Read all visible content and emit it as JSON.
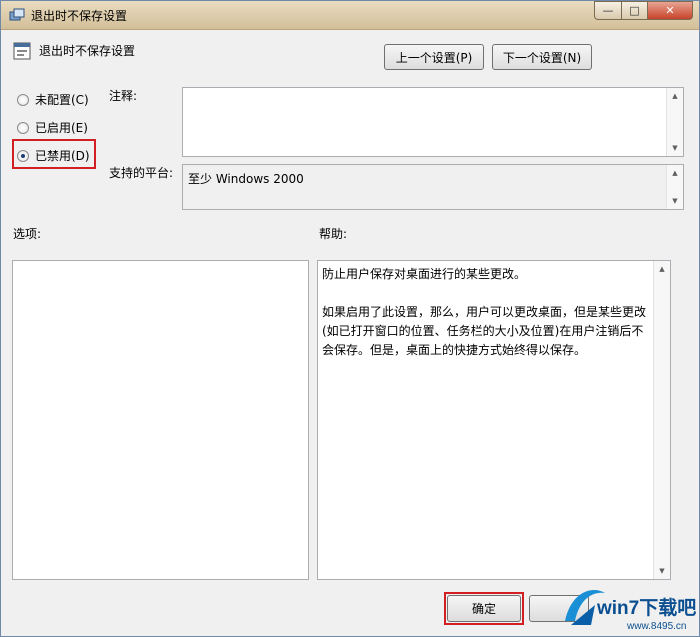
{
  "window": {
    "title": "退出时不保存设置"
  },
  "header": {
    "policy_title": "退出时不保存设置",
    "prev_button": "上一个设置(P)",
    "next_button": "下一个设置(N)"
  },
  "state_options": [
    {
      "label": "未配置(C)",
      "checked": false
    },
    {
      "label": "已启用(E)",
      "checked": false
    },
    {
      "label": "已禁用(D)",
      "checked": true
    }
  ],
  "comment": {
    "label": "注释:",
    "value": ""
  },
  "platform": {
    "label": "支持的平台:",
    "value": "至少 Windows 2000"
  },
  "options": {
    "label": "选项:"
  },
  "help": {
    "label": "帮助:",
    "text": "防止用户保存对桌面进行的某些更改。\n\n如果启用了此设置，那么，用户可以更改桌面，但是某些更改(如已打开窗口的位置、任务栏的大小及位置)在用户注销后不会保存。但是，桌面上的快捷方式始终得以保存。"
  },
  "footer": {
    "ok_button": "确定"
  },
  "watermark": {
    "brand": "win7下载吧",
    "url": "www.8495.cn"
  },
  "colors": {
    "highlight": "#d11f24",
    "accent": "#1d3c75"
  }
}
